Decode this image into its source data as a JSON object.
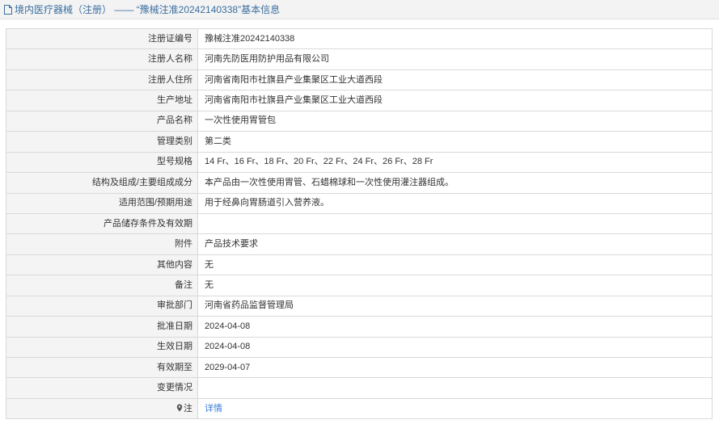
{
  "header": {
    "title": "境内医疗器械（注册） —— “豫械注准20242140338”基本信息"
  },
  "rows": [
    {
      "label": "注册证编号",
      "value": "豫械注准20242140338"
    },
    {
      "label": "注册人名称",
      "value": "河南先防医用防护用品有限公司"
    },
    {
      "label": "注册人住所",
      "value": "河南省南阳市社旗县产业集聚区工业大道西段"
    },
    {
      "label": "生产地址",
      "value": "河南省南阳市社旗县产业集聚区工业大道西段"
    },
    {
      "label": "产品名称",
      "value": "一次性使用胃管包"
    },
    {
      "label": "管理类别",
      "value": "第二类"
    },
    {
      "label": "型号规格",
      "value": "14 Fr、16 Fr、18 Fr、20 Fr、22 Fr、24 Fr、26 Fr、28 Fr"
    },
    {
      "label": "结构及组成/主要组成成分",
      "value": "本产品由一次性使用胃管、石蜡棉球和一次性使用灌注器组成。"
    },
    {
      "label": "适用范围/预期用途",
      "value": "用于经鼻向胃肠道引入营养液。"
    },
    {
      "label": "产品储存条件及有效期",
      "value": ""
    },
    {
      "label": "附件",
      "value": "产品技术要求"
    },
    {
      "label": "其他内容",
      "value": "无"
    },
    {
      "label": "备注",
      "value": "无"
    },
    {
      "label": "审批部门",
      "value": "河南省药品监督管理局"
    },
    {
      "label": "批准日期",
      "value": "2024-04-08"
    },
    {
      "label": "生效日期",
      "value": "2024-04-08"
    },
    {
      "label": "有效期至",
      "value": "2029-04-07"
    },
    {
      "label": "变更情况",
      "value": ""
    }
  ],
  "note": {
    "label": "注",
    "link_text": "详情",
    "icon": "map-pin-icon"
  },
  "colors": {
    "title_text": "#3a6f9f",
    "label_bg": "#f4f4f4",
    "border": "#d9d9d9",
    "link": "#3a7bd5"
  }
}
